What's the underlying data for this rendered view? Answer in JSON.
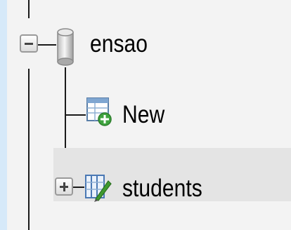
{
  "tree": {
    "database": {
      "name": "ensao",
      "icon": "database-icon",
      "expander": "collapse-icon"
    },
    "items": [
      {
        "label": "New",
        "icon": "new-table-icon"
      },
      {
        "label": "students",
        "icon": "table-edit-icon",
        "expander": "expand-icon"
      }
    ]
  }
}
